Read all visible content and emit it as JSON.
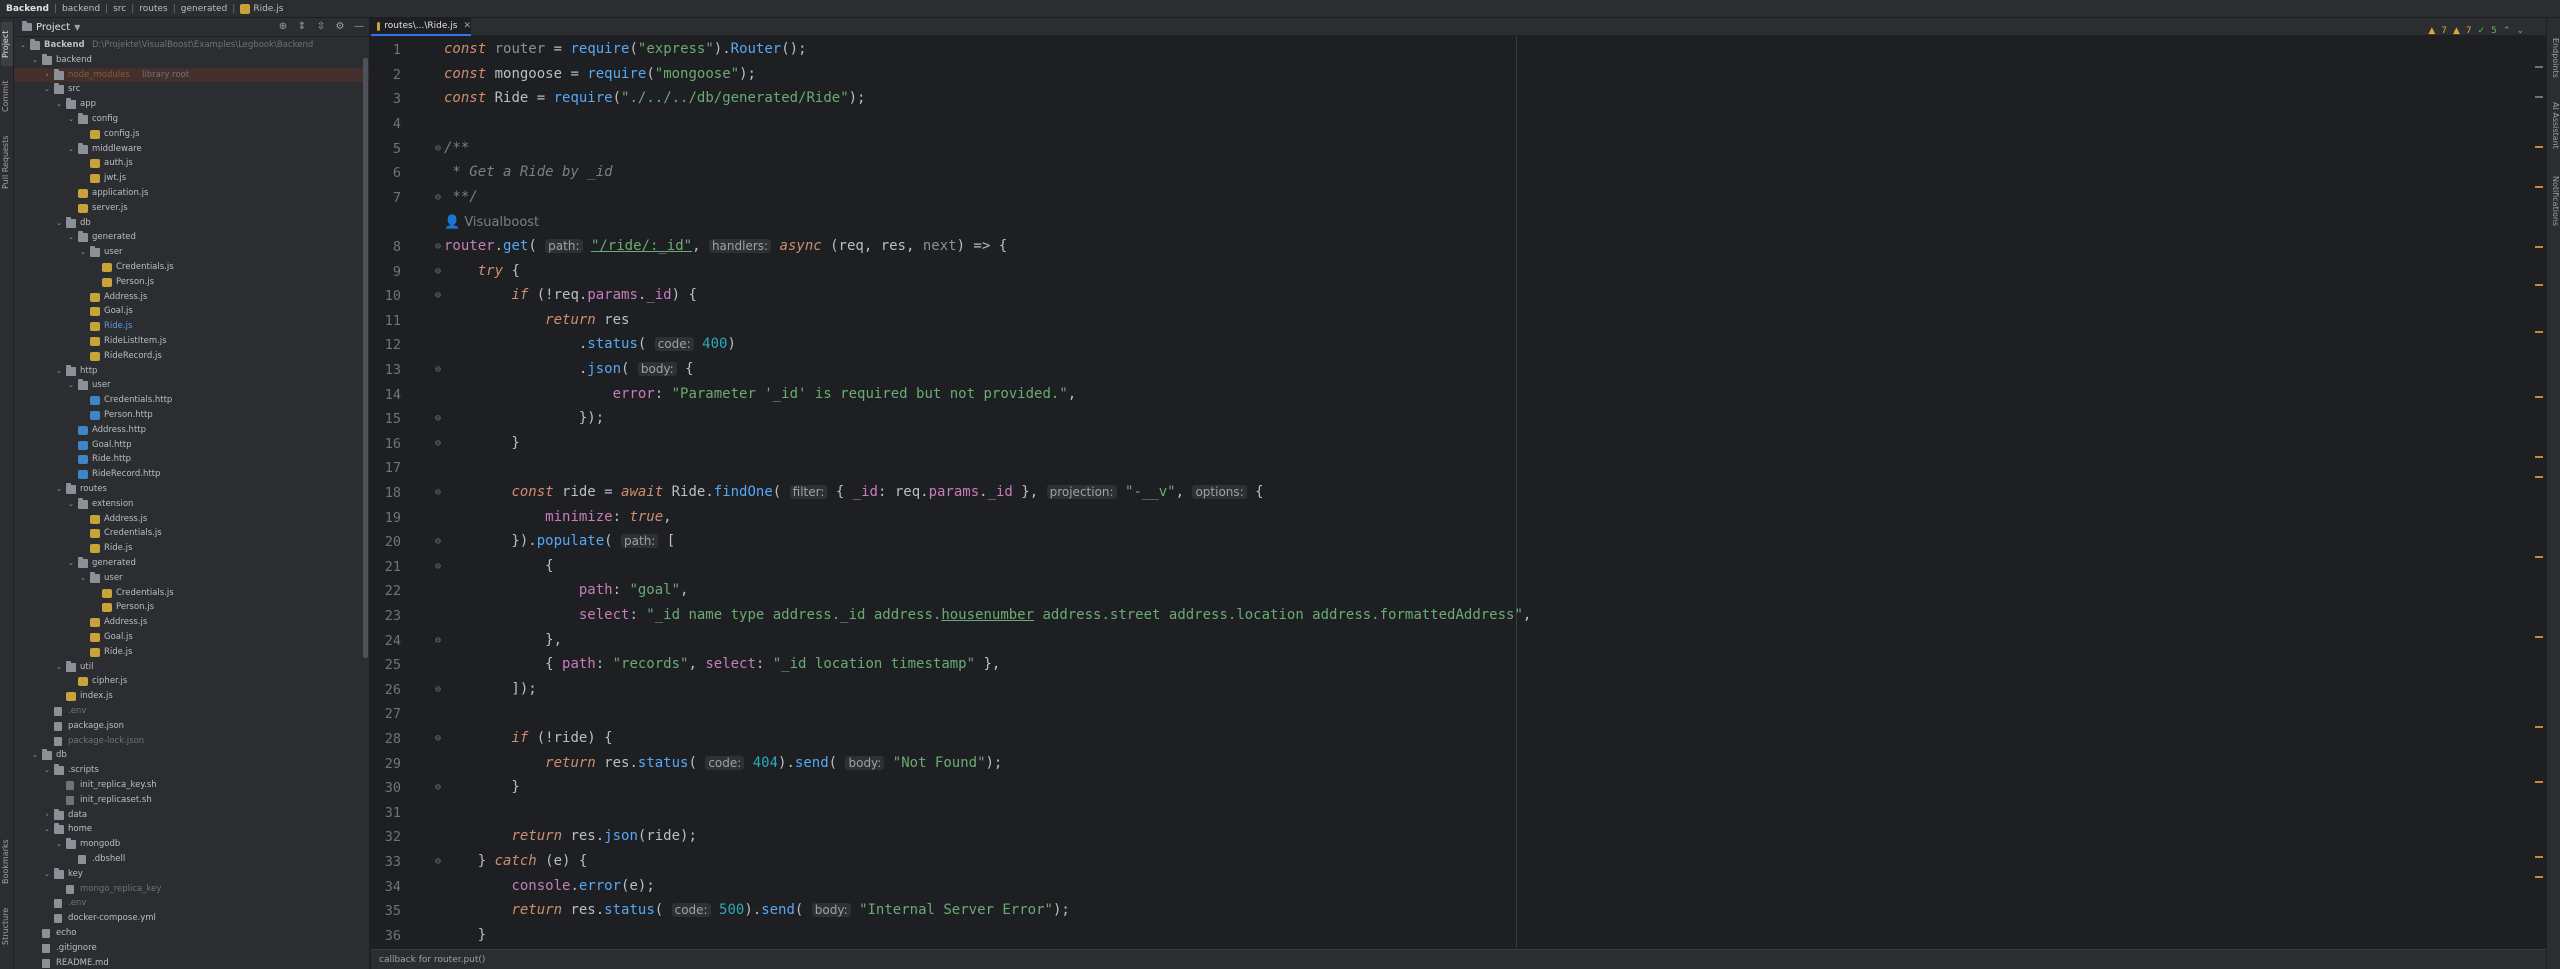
{
  "breadcrumbs": [
    "Backend",
    "backend",
    "src",
    "routes",
    "generated",
    "Ride.js"
  ],
  "left_strip": {
    "project": "Project",
    "commit": "Commit",
    "pull_requests": "Pull Requests",
    "bookmarks": "Bookmarks",
    "structure": "Structure"
  },
  "right_strip": {
    "endpoints": "Endpoints",
    "ai_assistant": "AI Assistant",
    "notifications": "Notifications"
  },
  "project_panel": {
    "title": "Project",
    "tree": [
      {
        "label": "Backend",
        "path": "D:\\Projekte\\VisualBoost\\Examples\\Legbook\\Backend",
        "type": "folder",
        "depth": 0,
        "open": true,
        "bold": true
      },
      {
        "label": "backend",
        "type": "folder",
        "depth": 1,
        "open": true
      },
      {
        "label": "node_modules",
        "hint": "library root",
        "type": "folder",
        "depth": 2,
        "open": false,
        "style": "ignored",
        "selected": true
      },
      {
        "label": "src",
        "type": "folder",
        "depth": 2,
        "open": true
      },
      {
        "label": "app",
        "type": "folder",
        "depth": 3,
        "open": true
      },
      {
        "label": "config",
        "type": "folder",
        "depth": 4,
        "open": true
      },
      {
        "label": "config.js",
        "type": "js",
        "depth": 5
      },
      {
        "label": "middleware",
        "type": "folder",
        "depth": 4,
        "open": true
      },
      {
        "label": "auth.js",
        "type": "js",
        "depth": 5
      },
      {
        "label": "jwt.js",
        "type": "js",
        "depth": 5
      },
      {
        "label": "application.js",
        "type": "js",
        "depth": 4
      },
      {
        "label": "server.js",
        "type": "js",
        "depth": 4
      },
      {
        "label": "db",
        "type": "folder",
        "depth": 3,
        "open": true
      },
      {
        "label": "generated",
        "type": "folder",
        "depth": 4,
        "open": true
      },
      {
        "label": "user",
        "type": "folder",
        "depth": 5,
        "open": true
      },
      {
        "label": "Credentials.js",
        "type": "js",
        "depth": 6
      },
      {
        "label": "Person.js",
        "type": "js",
        "depth": 6
      },
      {
        "label": "Address.js",
        "type": "js",
        "depth": 5
      },
      {
        "label": "Goal.js",
        "type": "js",
        "depth": 5
      },
      {
        "label": "Ride.js",
        "type": "js",
        "depth": 5,
        "style": "blue"
      },
      {
        "label": "RideListItem.js",
        "type": "js",
        "depth": 5
      },
      {
        "label": "RideRecord.js",
        "type": "js",
        "depth": 5
      },
      {
        "label": "http",
        "type": "folder",
        "depth": 3,
        "open": true
      },
      {
        "label": "user",
        "type": "folder",
        "depth": 4,
        "open": true
      },
      {
        "label": "Credentials.http",
        "type": "http",
        "depth": 5
      },
      {
        "label": "Person.http",
        "type": "http",
        "depth": 5
      },
      {
        "label": "Address.http",
        "type": "http",
        "depth": 4
      },
      {
        "label": "Goal.http",
        "type": "http",
        "depth": 4
      },
      {
        "label": "Ride.http",
        "type": "http",
        "depth": 4
      },
      {
        "label": "RideRecord.http",
        "type": "http",
        "depth": 4
      },
      {
        "label": "routes",
        "type": "folder",
        "depth": 3,
        "open": true
      },
      {
        "label": "extension",
        "type": "folder",
        "depth": 4,
        "open": true
      },
      {
        "label": "Address.js",
        "type": "js",
        "depth": 5
      },
      {
        "label": "Credentials.js",
        "type": "js",
        "depth": 5
      },
      {
        "label": "Ride.js",
        "type": "js",
        "depth": 5
      },
      {
        "label": "generated",
        "type": "folder",
        "depth": 4,
        "open": true
      },
      {
        "label": "user",
        "type": "folder",
        "depth": 5,
        "open": true
      },
      {
        "label": "Credentials.js",
        "type": "js",
        "depth": 6
      },
      {
        "label": "Person.js",
        "type": "js",
        "depth": 6
      },
      {
        "label": "Address.js",
        "type": "js",
        "depth": 5
      },
      {
        "label": "Goal.js",
        "type": "js",
        "depth": 5
      },
      {
        "label": "Ride.js",
        "type": "js",
        "depth": 5
      },
      {
        "label": "util",
        "type": "folder",
        "depth": 3,
        "open": true
      },
      {
        "label": "cipher.js",
        "type": "js",
        "depth": 4
      },
      {
        "label": "index.js",
        "type": "js",
        "depth": 3
      },
      {
        "label": ".env",
        "type": "file",
        "depth": 2,
        "style": "dim"
      },
      {
        "label": "package.json",
        "type": "json",
        "depth": 2
      },
      {
        "label": "package-lock.json",
        "type": "json",
        "depth": 2,
        "style": "dim"
      },
      {
        "label": "db",
        "type": "folder",
        "depth": 1,
        "open": true
      },
      {
        "label": ".scripts",
        "type": "folder",
        "depth": 2,
        "open": true
      },
      {
        "label": "init_replica_key.sh",
        "type": "sh",
        "depth": 3
      },
      {
        "label": "init_replicaset.sh",
        "type": "sh",
        "depth": 3
      },
      {
        "label": "data",
        "type": "folder",
        "depth": 2,
        "open": false
      },
      {
        "label": "home",
        "type": "folder",
        "depth": 2,
        "open": true
      },
      {
        "label": "mongodb",
        "type": "folder",
        "depth": 3,
        "open": true
      },
      {
        "label": ".dbshell",
        "type": "file",
        "depth": 4
      },
      {
        "label": "key",
        "type": "folder",
        "depth": 2,
        "open": true
      },
      {
        "label": "mongo_replica_key",
        "type": "file",
        "depth": 3,
        "style": "dim"
      },
      {
        "label": ".env",
        "type": "file",
        "depth": 2,
        "style": "dim"
      },
      {
        "label": "docker-compose.yml",
        "type": "file",
        "depth": 2
      },
      {
        "label": "echo",
        "type": "file",
        "depth": 1
      },
      {
        "label": ".gitignore",
        "type": "file",
        "depth": 1
      },
      {
        "label": "README.md",
        "type": "file",
        "depth": 1
      }
    ]
  },
  "editor": {
    "tab_label": "routes\\...\\Ride.js",
    "inspection": {
      "warnings_a": "7",
      "warnings_b": "7",
      "ok": "5"
    },
    "status_text": "callback for router.put()"
  }
}
